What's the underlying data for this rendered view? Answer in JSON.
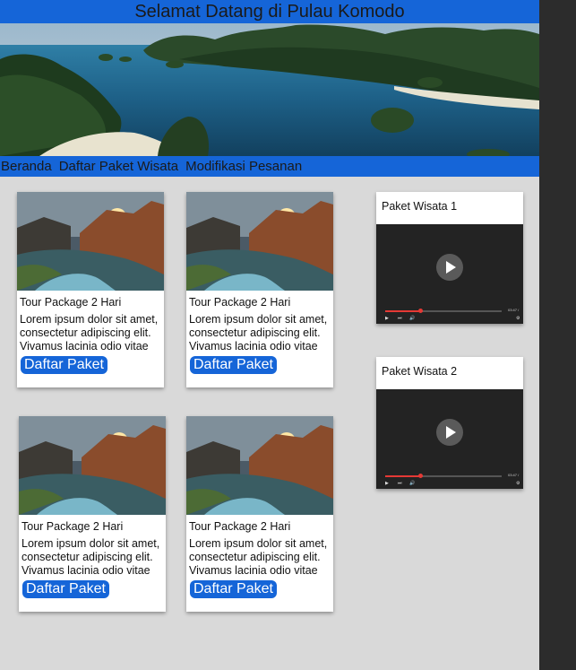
{
  "header": {
    "title": "Selamat Datang di Pulau Komodo"
  },
  "nav": {
    "items": [
      "Beranda",
      "Daftar Paket Wisata",
      "Modifikasi Pesanan"
    ]
  },
  "packages": [
    {
      "title": "Tour Package 2 Hari",
      "description": "Lorem ipsum dolor sit amet, consectetur adipiscing elit. Vivamus lacinia odio vitae",
      "button": "Daftar Paket"
    },
    {
      "title": "Tour Package 2 Hari",
      "description": "Lorem ipsum dolor sit amet, consectetur adipiscing elit. Vivamus lacinia odio vitae",
      "button": "Daftar Paket"
    },
    {
      "title": "Tour Package 2 Hari",
      "description": "Lorem ipsum dolor sit amet, consectetur adipiscing elit. Vivamus lacinia odio vitae",
      "button": "Daftar Paket"
    },
    {
      "title": "Tour Package 2 Hari",
      "description": "Lorem ipsum dolor sit amet, consectetur adipiscing elit. Vivamus lacinia odio vitae",
      "button": "Daftar Paket"
    }
  ],
  "videos": [
    {
      "title": "Paket Wisata 1",
      "time": "03:47 /",
      "progress": 0.3
    },
    {
      "title": "Paket Wisata 2",
      "time": "03:47 /",
      "progress": 0.3
    }
  ],
  "colors": {
    "accent": "#1565d8",
    "background": "#d9d9d9",
    "player": "#232323",
    "progress": "#e53935"
  },
  "icons": {
    "video": [
      "play-icon",
      "play-button-icon",
      "next-icon",
      "volume-icon",
      "settings-icon"
    ]
  }
}
